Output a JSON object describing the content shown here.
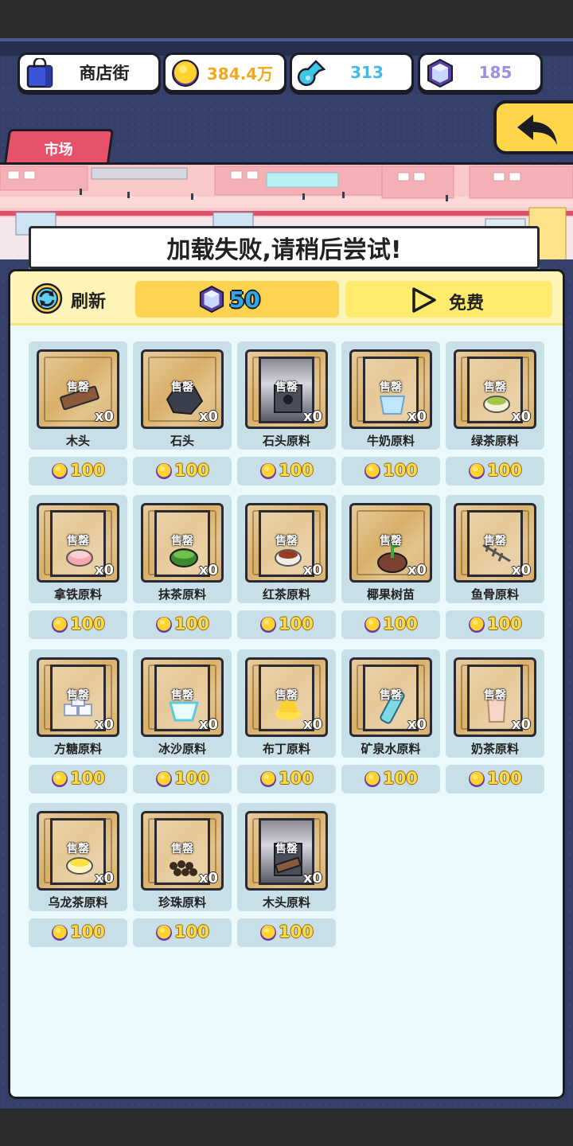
{
  "topbar": {
    "shop_name": "商店街",
    "coins": "384.4万",
    "potions": "313",
    "gems": "185"
  },
  "tab": {
    "label": "市场"
  },
  "toast": {
    "message": "加载失败,请稍后尝试!"
  },
  "actionbar": {
    "refresh_label": "刷新",
    "gem_refresh_cost": "50",
    "free_label": "免费"
  },
  "item_common": {
    "sold_label": "售罄",
    "quantity": "x0"
  },
  "items": [
    {
      "name": "木头",
      "price": "100",
      "icon": "wood-plank-icon"
    },
    {
      "name": "石头",
      "price": "100",
      "icon": "stone-icon"
    },
    {
      "name": "石头原料",
      "price": "100",
      "icon": "machine-icon"
    },
    {
      "name": "牛奶原料",
      "price": "100",
      "icon": "milk-icon"
    },
    {
      "name": "绿茶原料",
      "price": "100",
      "icon": "green-tea-icon"
    },
    {
      "name": "拿铁原料",
      "price": "100",
      "icon": "latte-icon"
    },
    {
      "name": "抹茶原料",
      "price": "100",
      "icon": "matcha-icon"
    },
    {
      "name": "红茶原料",
      "price": "100",
      "icon": "black-tea-icon"
    },
    {
      "name": "椰果树苗",
      "price": "100",
      "icon": "sapling-icon"
    },
    {
      "name": "鱼骨原料",
      "price": "100",
      "icon": "fishbone-icon"
    },
    {
      "name": "方糖原料",
      "price": "100",
      "icon": "sugar-cube-icon"
    },
    {
      "name": "冰沙原料",
      "price": "100",
      "icon": "smoothie-icon"
    },
    {
      "name": "布丁原料",
      "price": "100",
      "icon": "pudding-icon"
    },
    {
      "name": "矿泉水原料",
      "price": "100",
      "icon": "water-bottle-icon"
    },
    {
      "name": "奶茶原料",
      "price": "100",
      "icon": "milk-tea-icon"
    },
    {
      "name": "乌龙茶原料",
      "price": "100",
      "icon": "oolong-tea-icon"
    },
    {
      "name": "珍珠原料",
      "price": "100",
      "icon": "pearl-icon"
    },
    {
      "name": "木头原料",
      "price": "100",
      "icon": "wood-machine-icon"
    }
  ],
  "colors": {
    "gold": "#ffd94a",
    "accent_pink": "#e8516a",
    "back_yellow": "#ffd54a",
    "panel_bg": "#eaf9fb"
  }
}
